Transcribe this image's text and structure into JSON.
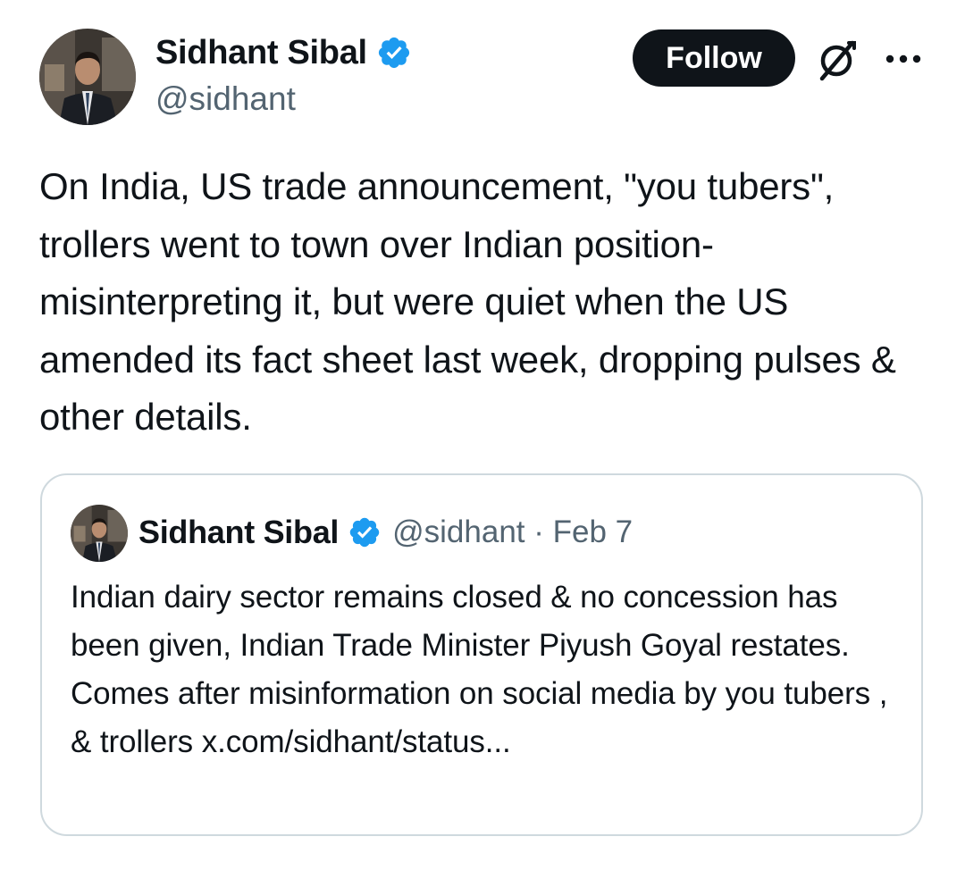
{
  "tweet": {
    "author": {
      "name": "Sidhant Sibal",
      "handle": "@sidhant",
      "verified": true
    },
    "follow_label": "Follow",
    "text": "On India, US trade announcement, \"you tubers\", trollers went to town over Indian position- misinterpreting it, but were quiet when the US amended its fact sheet last week, dropping pulses & other details."
  },
  "quoted_tweet": {
    "author": {
      "name": "Sidhant Sibal",
      "handle": "@sidhant",
      "verified": true
    },
    "meta": "@sidhant · Feb 7",
    "text": "Indian dairy sector remains closed & no concession has been given, Indian Trade Minister Piyush Goyal restates. Comes after misinformation on social media by you tubers , & trollers x.com/sidhant/status..."
  },
  "icons": {
    "verified": "verified-badge-icon",
    "grok": "grok-icon",
    "more": "more-options-icon"
  },
  "colors": {
    "text": "#0f1419",
    "secondary": "#536471",
    "verified": "#1d9bf0",
    "follow_bg": "#0f1419",
    "card_border": "#cfd9de"
  }
}
